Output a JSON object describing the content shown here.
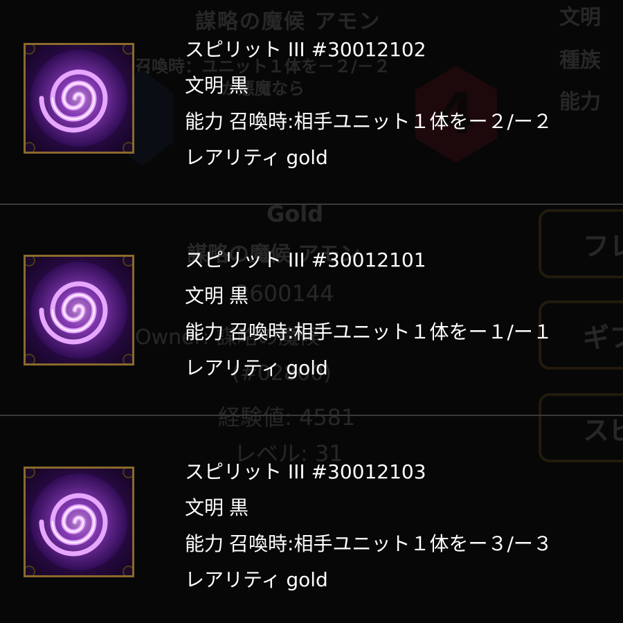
{
  "background": {
    "card_name": "謀略の魔候 アモン",
    "side_labels": [
      "文明",
      "種族",
      "能力"
    ],
    "ability_line_1": "召喚時：ユニット１体を－２/－２",
    "ability_line_2": "が悪魔なら",
    "cost": "4",
    "rarity": "Gold",
    "card_name_2": "謀略の魔候 アモン",
    "card_id": "2600144",
    "owner": "Owner: 謀略の魔候",
    "hash": "(#02800)",
    "exp": "経験値: 4581",
    "level": "レベル: 31",
    "buttons": [
      "フレ",
      "ギフト",
      "スピ"
    ]
  },
  "spirits": [
    {
      "title": "スピリット III #30012102",
      "civ_label": "文明",
      "civ_value": "黒",
      "ability_label": "能力",
      "ability_value": "召喚時:相手ユニット１体をー２/ー２",
      "rarity_label": "レアリティ",
      "rarity_value": "gold",
      "icon": "purple-swirl-icon"
    },
    {
      "title": "スピリット III #30012101",
      "civ_label": "文明",
      "civ_value": "黒",
      "ability_label": "能力",
      "ability_value": "召喚時:相手ユニット１体をー１/ー１",
      "rarity_label": "レアリティ",
      "rarity_value": "gold",
      "icon": "purple-swirl-icon"
    },
    {
      "title": "スピリット III #30012103",
      "civ_label": "文明",
      "civ_value": "黒",
      "ability_label": "能力",
      "ability_value": "召喚時:相手ユニット１体をー３/ー３",
      "rarity_label": "レアリティ",
      "rarity_value": "gold",
      "icon": "purple-swirl-icon"
    }
  ],
  "colors": {
    "background": "#070707",
    "divider": "#3a3a3a",
    "text": "#ffffff",
    "thumb_border": "#8c6a2c",
    "swirl": "#b04bf0"
  }
}
